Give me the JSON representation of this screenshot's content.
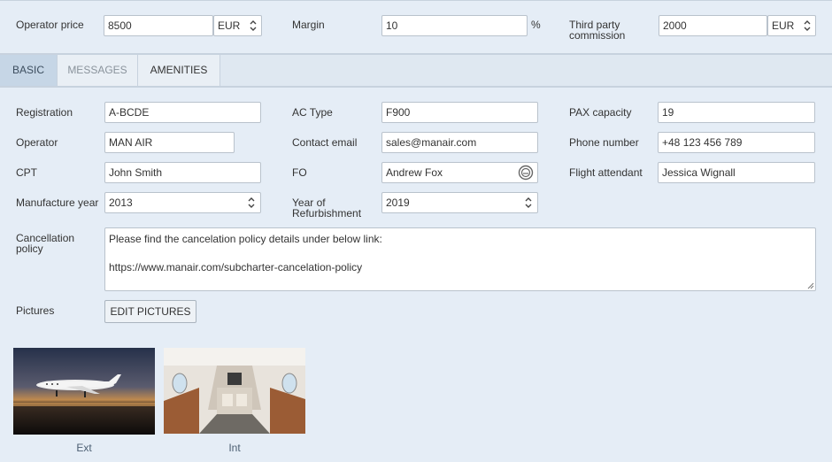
{
  "pricing": {
    "operator_price_label": "Operator price",
    "operator_price_value": "8500",
    "operator_price_currency": "EUR",
    "margin_label": "Margin",
    "margin_value": "10",
    "margin_unit": "%",
    "third_party_label_1": "Third party",
    "third_party_label_2": "commission",
    "third_party_value": "2000",
    "third_party_currency": "EUR"
  },
  "tabs": [
    {
      "label": "BASIC"
    },
    {
      "label": "MESSAGES"
    },
    {
      "label": "AMENITIES"
    }
  ],
  "form": {
    "registration_label": "Registration",
    "registration_value": "A-BCDE",
    "ac_type_label": "AC Type",
    "ac_type_value": "F900",
    "pax_label": "PAX capacity",
    "pax_value": "19",
    "operator_label": "Operator",
    "operator_value": "MAN AIR",
    "contact_email_label": "Contact email",
    "contact_email_value": "sales@manair.com",
    "phone_label": "Phone number",
    "phone_value": "+48 123 456 789",
    "cpt_label": "CPT",
    "cpt_value": "John Smith",
    "fo_label": "FO",
    "fo_value": "Andrew Fox",
    "attendant_label": "Flight attendant",
    "attendant_value": "Jessica Wignall",
    "manufacture_label": "Manufacture year",
    "manufacture_value": "2013",
    "refurb_label_1": "Year of",
    "refurb_label_2": "Refurbishment",
    "refurb_value": "2019",
    "cancellation_label_1": "Cancellation",
    "cancellation_label_2": "policy",
    "cancellation_value": "Please find the cancelation policy details under below link:\n\nhttps://www.manair.com/subcharter-cancelation-policy",
    "pictures_label": "Pictures",
    "edit_pictures_label": "EDIT PICTURES"
  },
  "pictures": [
    {
      "caption": "Ext"
    },
    {
      "caption": "Int"
    }
  ],
  "icons": {
    "fo_field_icon": "contact-card-icon",
    "select_icon": "updown-chevron-icon"
  }
}
